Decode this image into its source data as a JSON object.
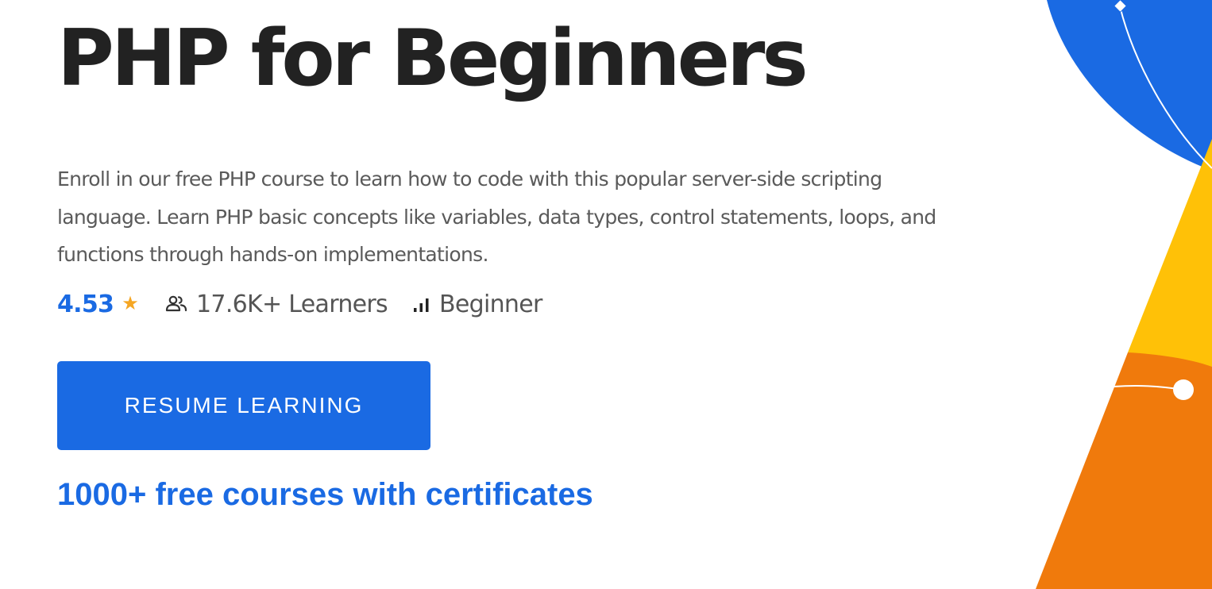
{
  "course": {
    "title": "PHP for Beginners",
    "description": "Enroll in our free PHP course to learn how to code with this popular server-side scripting language. Learn PHP basic concepts like variables, data types, control statements, loops, and functions through hands-on implementations.",
    "rating": "4.53",
    "learners": "17.6K+ Learners",
    "level": "Beginner"
  },
  "actions": {
    "resume_label": "RESUME LEARNING"
  },
  "promo": {
    "tagline": "1000+ free courses with certificates"
  },
  "icons": {
    "rating": "star-icon",
    "learners": "people-icon",
    "level": "signal-bars-icon"
  },
  "colors": {
    "brand_blue": "#1a6ae3",
    "title_text": "#222222",
    "body_text": "#5a5a5a",
    "star": "#f5a623",
    "decor_blue": "#1a6ae3",
    "decor_yellow": "#ffc107",
    "decor_orange": "#f07a0c"
  }
}
